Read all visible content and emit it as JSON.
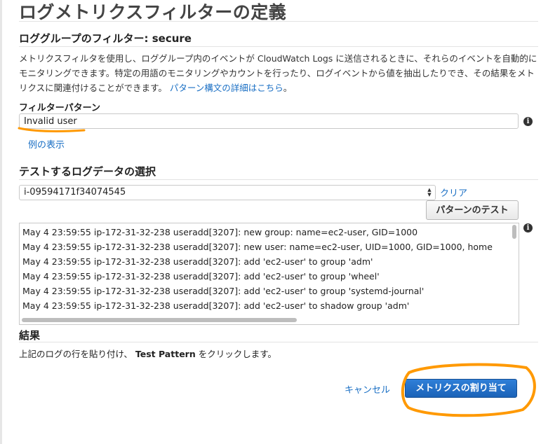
{
  "page": {
    "title": "ログメトリクスフィルターの定義"
  },
  "filter_section": {
    "title": "ロググループのフィルター: secure",
    "description": "メトリクスフィルタを使用し、ロググループ内のイベントが CloudWatch Logs に送信されるときに、それらのイベントを自動的にモニタリングできます。特定の用語のモニタリングやカウントを行ったり、ログイベントから値を抽出したりでき、その結果をメトリクスに関連付けることができます。",
    "description_link": "パターン構文の詳細はこちら",
    "description_end": "。"
  },
  "filter_pattern": {
    "label": "フィルターパターン",
    "value": "Invalid user",
    "examples_link": "例の表示"
  },
  "test_data": {
    "label": "テストするログデータの選択",
    "selected": "i-09594171f34074545",
    "clear_link": "クリア",
    "test_button": "パターンのテスト",
    "log_lines": [
      "May  4 23:59:55 ip-172-31-32-238 useradd[3207]: new group: name=ec2-user, GID=1000",
      "May  4 23:59:55 ip-172-31-32-238 useradd[3207]: new user: name=ec2-user, UID=1000, GID=1000, home",
      "May  4 23:59:55 ip-172-31-32-238 useradd[3207]: add 'ec2-user' to group 'adm'",
      "May  4 23:59:55 ip-172-31-32-238 useradd[3207]: add 'ec2-user' to group 'wheel'",
      "May  4 23:59:55 ip-172-31-32-238 useradd[3207]: add 'ec2-user' to group 'systemd-journal'",
      "May  4 23:59:55 ip-172-31-32-238 useradd[3207]: add 'ec2-user' to shadow group 'adm'"
    ]
  },
  "results": {
    "title": "結果",
    "text_before": "上記のログの行を貼り付け、",
    "text_bold": "Test Pattern",
    "text_after": "をクリックします。"
  },
  "actions": {
    "cancel": "キャンセル",
    "assign": "メトリクスの割り当て"
  },
  "colors": {
    "link": "#1a6fc4",
    "primary_button": "#1f6ec7",
    "highlight": "#ff9900"
  },
  "icons": [
    "info-icon",
    "select-arrows-icon"
  ]
}
